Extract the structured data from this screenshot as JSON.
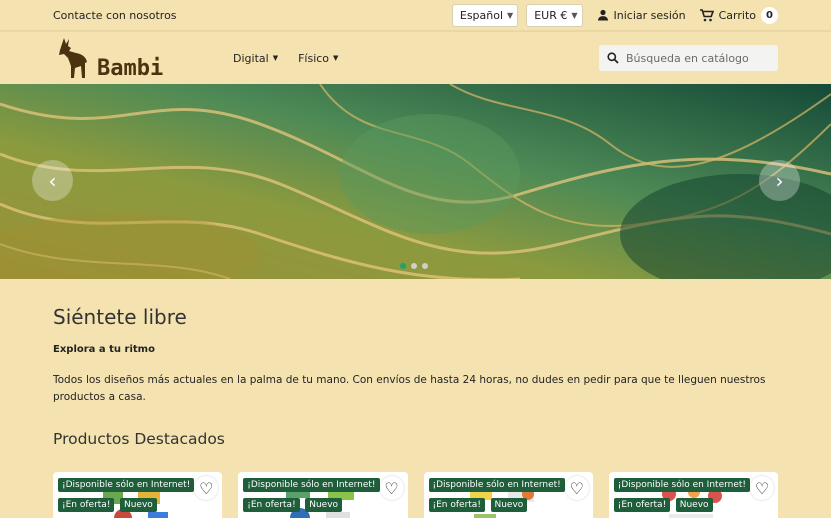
{
  "topbar": {
    "contact": "Contacte con nosotros",
    "language": "Español",
    "currency": "EUR €",
    "signin": "Iniciar sesión",
    "cart_label": "Carrito",
    "cart_count": "0"
  },
  "header": {
    "brand": "Bambi",
    "nav": [
      "Digital",
      "Físico"
    ],
    "search_placeholder": "Búsqueda en catálogo"
  },
  "hero": {
    "slides": 3,
    "active_slide": 1
  },
  "intro": {
    "title": "Siéntete libre",
    "subtitle": "Explora a tu ritmo",
    "text": "Todos los diseños más actuales en la palma de tu mano. Con envíos de hasta 24 horas, no dudes en pedir para que te lleguen nuestros productos a casa."
  },
  "featured": {
    "title": "Productos Destacados",
    "products": [
      {
        "flag_online": "¡Disponible sólo en Internet!",
        "flag_sale": "¡En oferta!",
        "flag_new": "Nuevo"
      },
      {
        "flag_online": "¡Disponible sólo en Internet!",
        "flag_sale": "¡En oferta!",
        "flag_new": "Nuevo"
      },
      {
        "flag_online": "¡Disponible sólo en Internet!",
        "flag_sale": "¡En oferta!",
        "flag_new": "Nuevo"
      },
      {
        "flag_online": "¡Disponible sólo en Internet!",
        "flag_sale": "¡En oferta!",
        "flag_new": "Nuevo"
      }
    ]
  },
  "colors": {
    "background": "#f4e3b0",
    "flag": "#1e5e3a",
    "brand": "#4b3310",
    "active_dot": "#24a06a"
  },
  "icons": [
    "user-icon",
    "cart-icon",
    "search-icon",
    "chevron-left-icon",
    "chevron-right-icon",
    "heart-icon",
    "deer-logo-icon"
  ]
}
